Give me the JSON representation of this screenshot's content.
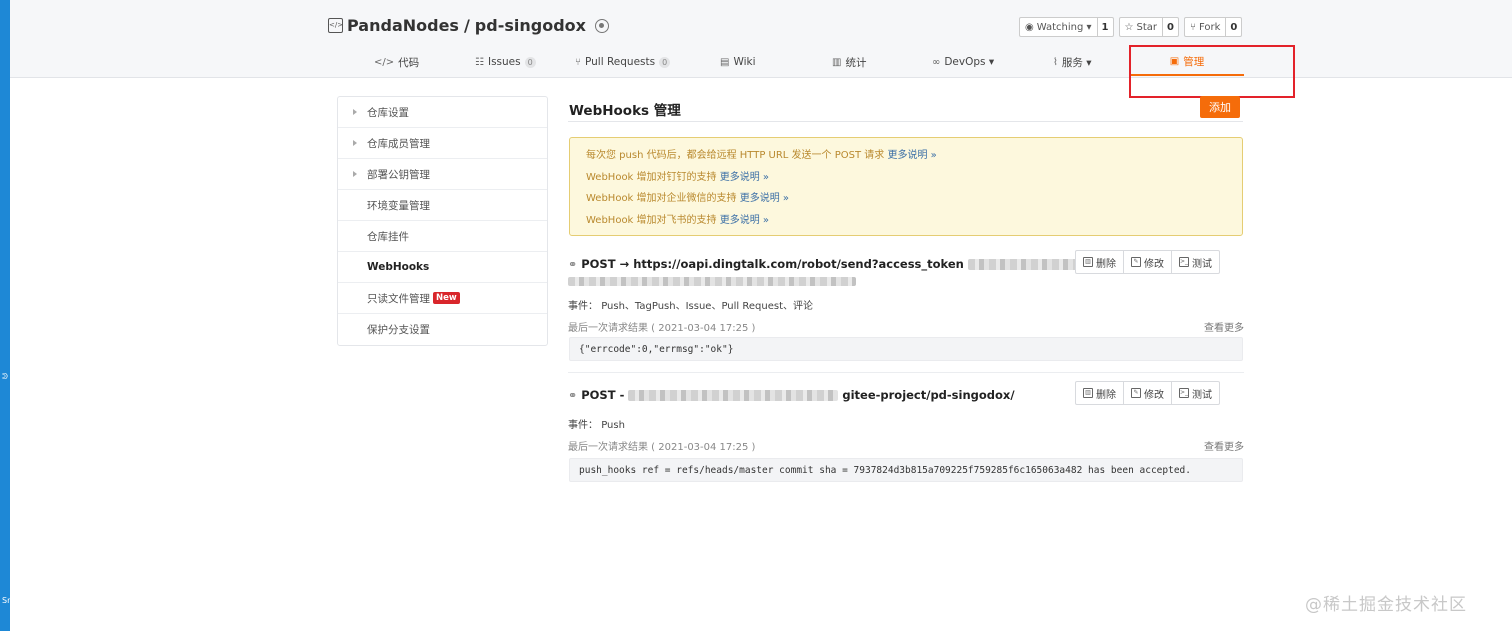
{
  "repo": {
    "owner": "PandaNodes",
    "separator": "/",
    "name": "pd-singodox",
    "icon": "repo-code-icon"
  },
  "repo_actions": [
    {
      "label": "Watching ▾",
      "count": "1",
      "icon": "eye-icon"
    },
    {
      "label": "Star",
      "count": "0",
      "icon": "star-icon"
    },
    {
      "label": "Fork",
      "count": "0",
      "icon": "fork-icon"
    }
  ],
  "tabs": [
    {
      "glyph": "</>",
      "label": "代码",
      "count": ""
    },
    {
      "glyph": "☷",
      "label": "Issues",
      "count": "0"
    },
    {
      "glyph": "⑂",
      "label": "Pull Requests",
      "count": "0"
    },
    {
      "glyph": "▤",
      "label": "Wiki",
      "count": ""
    },
    {
      "glyph": "▥",
      "label": "统计",
      "count": ""
    },
    {
      "glyph": "∞",
      "label": "DevOps ▾",
      "count": ""
    },
    {
      "glyph": "⌇",
      "label": "服务 ▾",
      "count": ""
    },
    {
      "glyph": "▣",
      "label": "管理",
      "count": ""
    }
  ],
  "sidebar": {
    "items": [
      {
        "label": "仓库设置",
        "caret": true
      },
      {
        "label": "仓库成员管理",
        "caret": true
      },
      {
        "label": "部署公钥管理",
        "caret": true
      },
      {
        "label": "环境变量管理",
        "caret": false
      },
      {
        "label": "仓库挂件",
        "caret": false
      },
      {
        "label": "WebHooks",
        "caret": false
      },
      {
        "label": "只读文件管理",
        "caret": false,
        "badge": "New"
      },
      {
        "label": "保护分支设置",
        "caret": false
      }
    ]
  },
  "main": {
    "title": "WebHooks 管理",
    "add_label": "添加"
  },
  "notice": [
    {
      "text": "每次您 push 代码后，都会给远程 HTTP URL 发送一个 POST 请求",
      "link": "更多说明 »"
    },
    {
      "text": "WebHook 增加对钉钉的支持",
      "link": "更多说明 »"
    },
    {
      "text": "WebHook 增加对企业微信的支持",
      "link": "更多说明 »"
    },
    {
      "text": "WebHook 增加对飞书的支持",
      "link": "更多说明 »"
    }
  ],
  "hooks": [
    {
      "method": "POST",
      "arrow": "→",
      "url": "https://oapi.dingtalk.com/robot/send?access_token",
      "events_label": "事件：",
      "events": "Push、TagPush、Issue、Pull Request、评论",
      "last_label": "最后一次请求结果 ( 2021-03-04 17:25 )",
      "more": "查看更多",
      "result": "{\"errcode\":0,\"errmsg\":\"ok\"}"
    },
    {
      "method": "POST",
      "arrow": "-",
      "url": "gitee-project/pd-singodox/",
      "events_label": "事件：",
      "events": "Push",
      "last_label": "最后一次请求结果 ( 2021-03-04 17:25 )",
      "more": "查看更多",
      "result": "push_hooks ref = refs/heads/master commit sha = 7937824d3b815a709225f759285f6c165063a482 has been accepted."
    }
  ],
  "hook_actions": {
    "delete": "删除",
    "edit": "修改",
    "test": "测试"
  },
  "left_strip_marks": [
    "ᕲ",
    "Sr"
  ],
  "watermark": "@稀土掘金技术社区",
  "colors": {
    "accent": "#f56c0a",
    "highlight": "#e3222a",
    "notice_bg": "#fdf8dd",
    "link": "#3b6fa6"
  }
}
